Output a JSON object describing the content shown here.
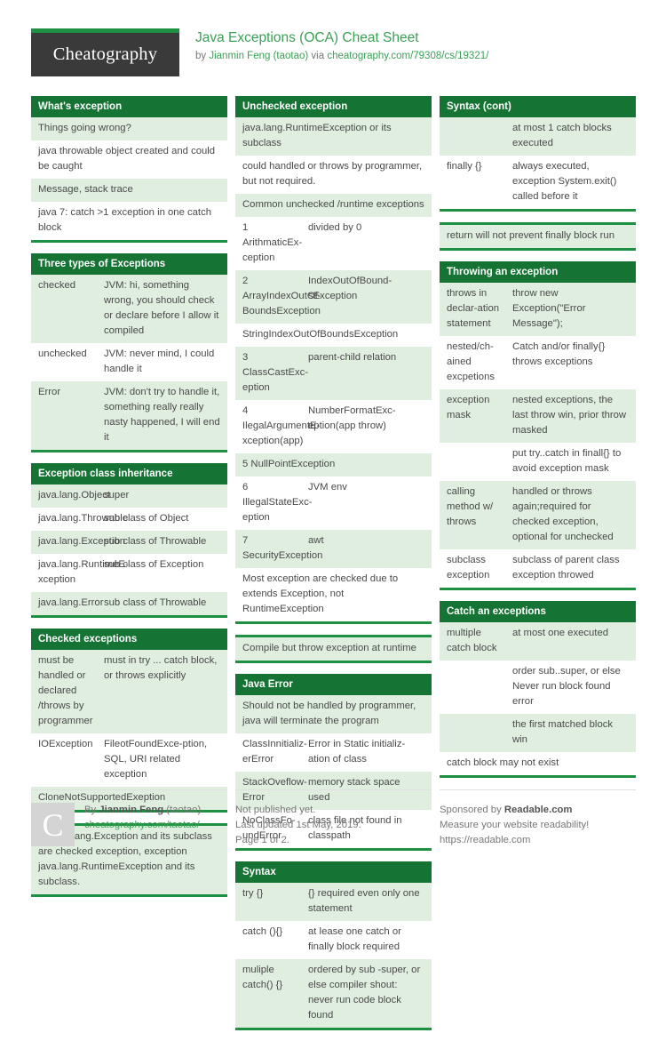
{
  "header": {
    "logo": "Cheatography",
    "title": "Java Exceptions (OCA) Cheat Sheet",
    "by_prefix": "by ",
    "author": "Jianmin Feng (taotao)",
    "via": " via ",
    "source_url": "cheatography.com/79308/cs/19321/"
  },
  "colors": {
    "header_green": "#157333",
    "accent_green": "#1d9141",
    "row_alt": "#dfeedf",
    "link_green": "#3aa155",
    "logo_bg": "#3a3a3a"
  },
  "columns": [
    {
      "cards": [
        {
          "title": "What's exception",
          "rows": [
            {
              "full": true,
              "c2": "Things going wrong?"
            },
            {
              "full": true,
              "c2": "java throwable object created and could be caught"
            },
            {
              "full": true,
              "c2": "Message, stack trace"
            },
            {
              "full": true,
              "c2": "java 7: catch >1 exception in one catch block"
            }
          ]
        },
        {
          "title": "Three types of Exceptions",
          "col1": "narrow-wide",
          "rows": [
            {
              "c1": "checked",
              "c2": "JVM: hi, something wrong, you should check or declare before I allow it compiled"
            },
            {
              "c1": "unchecked",
              "c2": "JVM: never mind, I could handle it"
            },
            {
              "c1": "Error",
              "c2": "JVM: don't try to handle it, something really really nasty happened, I will end it"
            }
          ]
        },
        {
          "title": "Exception class inheritance",
          "rows": [
            {
              "c1": "java.lang.Object",
              "c2": "super"
            },
            {
              "c1": "java.lang.Throwable",
              "c2": "sub class of Object"
            },
            {
              "c1": "java.lang.Exception",
              "c2": "sub class of Throwable"
            },
            {
              "c1": "java.lang.RuntimeE-xception",
              "c2": "sub class of Exception"
            },
            {
              "c1": "java.lang.Error",
              "c2": "sub class of Throwable"
            }
          ]
        },
        {
          "title": "Checked exceptions",
          "rows": [
            {
              "c1": "must be handled or declared /throws by programmer",
              "c2": "must in try ... catch block, or throws explicitly"
            },
            {
              "c1": "IOException",
              "c2": "FileotFoundExce-ption, SQL, URI related exception"
            },
            {
              "full": true,
              "c2": "CloneNotSupportedExeption"
            }
          ]
        },
        {
          "title": null,
          "rows": [
            {
              "full": true,
              "c2": "all java.lang.Exception and its subclass are checked exception, exception java.lang.RuntimeException and its subclass."
            }
          ]
        }
      ]
    },
    {
      "cards": [
        {
          "title": "Unchecked exception",
          "rows": [
            {
              "full": true,
              "c2": "java.lang.RuntimeException or its subclass"
            },
            {
              "full": true,
              "c2": "could handled or throws by programmer, but not required."
            },
            {
              "full": true,
              "c2": "Common unchecked /runtime exceptions"
            },
            {
              "c1": "1 ArithmaticEx-ception",
              "c2": "divided by 0"
            },
            {
              "c1": "2 ArrayIndexOutOf-BoundsException",
              "c2": "IndexOutOfBound-sException"
            },
            {
              "full": true,
              "c2": "StringIndexOutOfBoundsException"
            },
            {
              "c1": "3 ClassCastExc-eption",
              "c2": "parent-child relation"
            },
            {
              "c1": "4 IlegalArgumentE-xception(app)",
              "c2": "NumberFormatExc-eption(app throw)"
            },
            {
              "full": true,
              "c2": "5 NullPointException"
            },
            {
              "c1": "6 IllegalStateExc-eption",
              "c2": "JVM env"
            },
            {
              "c1": "7 SecurityException",
              "c2": "awt"
            },
            {
              "full": true,
              "c2": "Most exception are checked due to extends Exception, not RuntimeException"
            }
          ]
        },
        {
          "title": null,
          "rows": [
            {
              "full": true,
              "c2": "Compile but throw exception at runtime"
            }
          ]
        },
        {
          "title": "Java Error",
          "rows": [
            {
              "full": true,
              "c2": "Should not be handled by programmer, java will terminate the program"
            },
            {
              "c1": "ClassInnitializ-erError",
              "c2": "Error in Static initializ-ation of class"
            },
            {
              "c1": "StackOveflow-Error",
              "c2": "memory stack space used"
            },
            {
              "c1": "NoClassFo-undError",
              "c2": "class file not found in classpath"
            }
          ]
        },
        {
          "title": "Syntax",
          "rows": [
            {
              "c1": "try {}",
              "c2": "{} required even only one statement"
            },
            {
              "c1": "catch (){}",
              "c2": "at lease one catch or finally block required"
            },
            {
              "c1": "muliple catch() {}",
              "c2": "ordered by sub -super, or else compiler shout: never run code block found"
            }
          ]
        }
      ]
    },
    {
      "cards": [
        {
          "title": "Syntax (cont)",
          "rows": [
            {
              "c1": "",
              "c2": "at most 1 catch blocks executed"
            },
            {
              "c1": "finally {}",
              "c2": "always executed, exception System.exit() called before it"
            }
          ]
        },
        {
          "title": null,
          "rows": [
            {
              "full": true,
              "c2": "return will not prevent finally block run"
            }
          ]
        },
        {
          "title": "Throwing an exception",
          "rows": [
            {
              "c1": "throws in declar-ation statement",
              "c2": "throw new Exception(\"Error Message\");"
            },
            {
              "c1": "nested/ch-ained excpetions",
              "c2": "Catch and/or finally{} throws exceptions"
            },
            {
              "c1": "exception mask",
              "c2": "nested exceptions, the last throw win, prior throw masked"
            },
            {
              "c1": "",
              "c2": "put try..catch in finall{} to avoid exception mask"
            },
            {
              "c1": "calling method w/ throws",
              "c2": "handled or throws again;required for checked exception, optional for unchecked"
            },
            {
              "c1": "subclass exception",
              "c2": "subclass of parent class exception throwed"
            }
          ]
        },
        {
          "title": "Catch an exceptions",
          "rows": [
            {
              "c1": "multiple catch block",
              "c2": "at most one executed"
            },
            {
              "c1": "",
              "c2": "order sub..super, or else Never run block found error"
            },
            {
              "c1": "",
              "c2": "the first matched block win"
            },
            {
              "full": true,
              "c2": "catch block may not exist"
            }
          ]
        }
      ]
    }
  ],
  "footer": {
    "avatar_letter": "C",
    "by_label": "By ",
    "author": "Jianmin Feng",
    "author_handle": " (taotao)",
    "author_url": "cheatography.com/taotao/",
    "publish_status": "Not published yet.",
    "last_updated": "Last updated 1st May, 2019.",
    "page_number": "Page 1 of 2.",
    "sponsor_prefix": "Sponsored by ",
    "sponsor_name": "Readable.com",
    "sponsor_tagline": "Measure your website readability!",
    "sponsor_url": "https://readable.com"
  }
}
